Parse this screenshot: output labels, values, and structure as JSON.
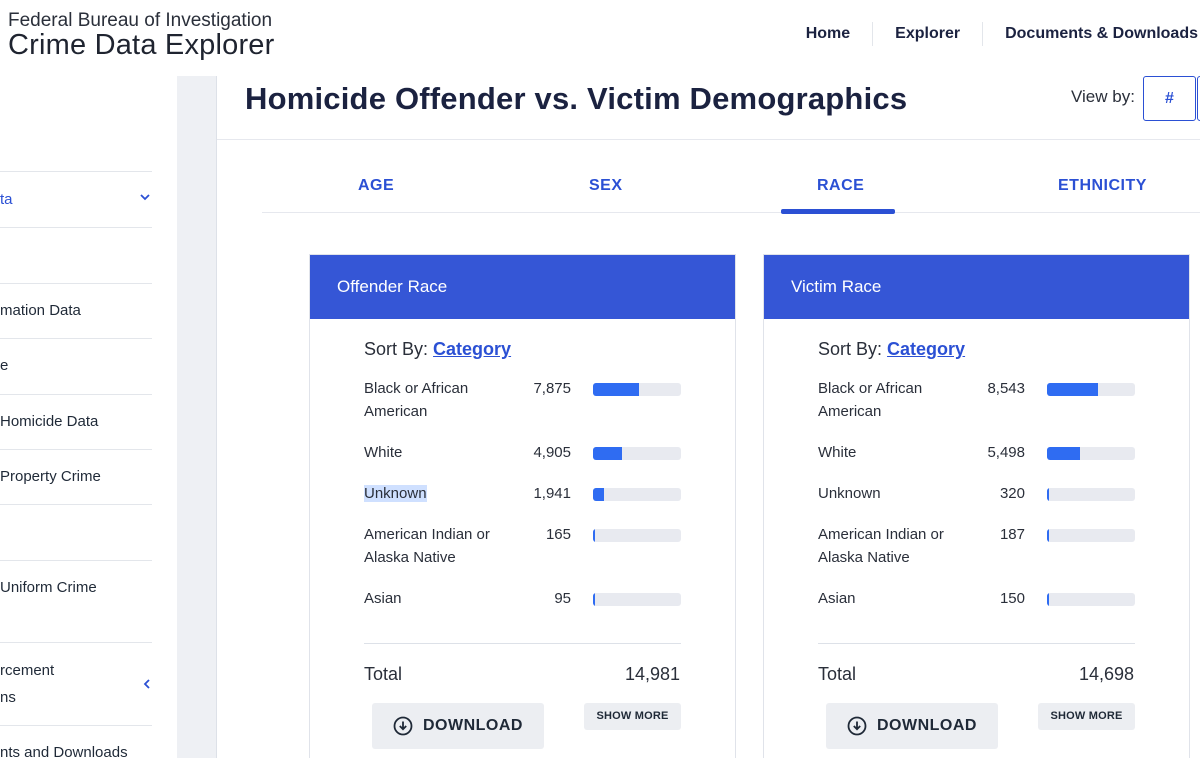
{
  "header": {
    "agency": "Federal Bureau of Investigation",
    "app_name": "Crime Data Explorer",
    "nav": [
      "Home",
      "Explorer",
      "Documents & Downloads"
    ]
  },
  "sidebar": {
    "items": [
      {
        "label": "ta",
        "active": true
      },
      {
        "label": "mation Data"
      },
      {
        "label": "e"
      },
      {
        "label": "Homicide Data"
      },
      {
        "label": "Property Crime"
      },
      {
        "label": "Uniform Crime"
      },
      {
        "label": "rcement"
      },
      {
        "label": "ns"
      },
      {
        "label": "nts and Downloads"
      }
    ]
  },
  "page": {
    "title": "Homicide Offender vs. Victim Demographics",
    "view_by_label": "View by:",
    "view_by_option": "#"
  },
  "tabs": [
    {
      "label": "AGE"
    },
    {
      "label": "SEX"
    },
    {
      "label": "RACE",
      "active": true
    },
    {
      "label": "ETHNICITY"
    }
  ],
  "cards": [
    {
      "title": "Offender Race",
      "sort_label": "Sort By:",
      "sort_value": "Category",
      "rows": [
        {
          "label": "Black or African American",
          "value": "7,875",
          "fraction": 0.526
        },
        {
          "label": "White",
          "value": "4,905",
          "fraction": 0.327
        },
        {
          "label": "Unknown",
          "value": "1,941",
          "fraction": 0.13,
          "highlighted": true
        },
        {
          "label": "American Indian or Alaska Native",
          "value": "165",
          "fraction": 0.011
        },
        {
          "label": "Asian",
          "value": "95",
          "fraction": 0.006
        }
      ],
      "total_label": "Total",
      "total_value": "14,981",
      "download_label": "DOWNLOAD",
      "show_more_label": "SHOW MORE"
    },
    {
      "title": "Victim Race",
      "sort_label": "Sort By:",
      "sort_value": "Category",
      "rows": [
        {
          "label": "Black or African American",
          "value": "8,543",
          "fraction": 0.581
        },
        {
          "label": "White",
          "value": "5,498",
          "fraction": 0.374
        },
        {
          "label": "Unknown",
          "value": "320",
          "fraction": 0.022
        },
        {
          "label": "American Indian or Alaska Native",
          "value": "187",
          "fraction": 0.013
        },
        {
          "label": "Asian",
          "value": "150",
          "fraction": 0.01
        }
      ],
      "total_label": "Total",
      "total_value": "14,698",
      "download_label": "DOWNLOAD",
      "show_more_label": "SHOW MORE"
    }
  ],
  "colors": {
    "accent": "#2b50d4",
    "card_header": "#3556d6",
    "bar_fill": "#2f6cf2",
    "bar_track": "#e8eaf0"
  }
}
